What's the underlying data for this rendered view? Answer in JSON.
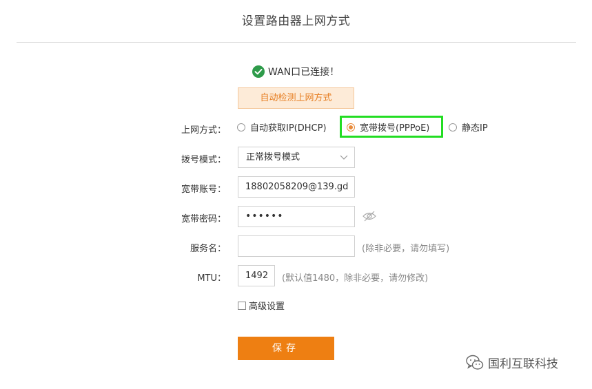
{
  "page": {
    "title": "设置路由器上网方式"
  },
  "status": {
    "text": "WAN口已连接！"
  },
  "detect": {
    "label": "自动检测上网方式"
  },
  "connection": {
    "label": "上网方式：",
    "options": [
      {
        "label": "自动获取IP(DHCP)",
        "checked": false
      },
      {
        "label": "宽带拨号(PPPoE)",
        "checked": true
      },
      {
        "label": "静态IP",
        "checked": false
      }
    ]
  },
  "dial_mode": {
    "label": "拨号模式：",
    "value": "正常拨号模式"
  },
  "account": {
    "label": "宽带账号：",
    "value": "18802058209@139.gd"
  },
  "password": {
    "label": "宽带密码：",
    "value": "••••••"
  },
  "service": {
    "label": "服务名：",
    "value": "",
    "hint": "(除非必要，请勿填写)"
  },
  "mtu": {
    "label": "MTU：",
    "value": "1492",
    "hint": "(默认值1480，除非必要，请勿修改)"
  },
  "advanced": {
    "label": "高级设置"
  },
  "save": {
    "label": "保存"
  },
  "watermark": {
    "text": "国利互联科技"
  },
  "colors": {
    "accent": "#ee7f12",
    "highlight": "#22dd22",
    "success": "#2e9b4a"
  }
}
